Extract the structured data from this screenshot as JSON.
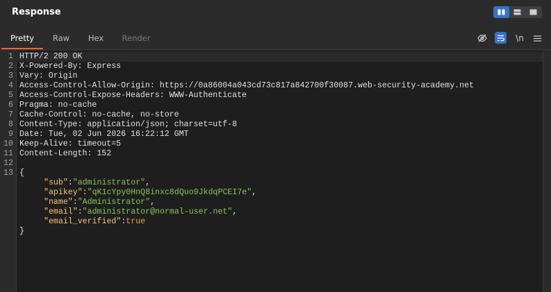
{
  "header": {
    "title": "Response"
  },
  "tabs": [
    {
      "label": "Pretty",
      "state": "active"
    },
    {
      "label": "Raw",
      "state": "normal"
    },
    {
      "label": "Hex",
      "state": "normal"
    },
    {
      "label": "Render",
      "state": "disabled"
    }
  ],
  "toolbar": {
    "hide_icon": "eye-slash-icon",
    "wrap_icon": "word-wrap-icon",
    "newline_label": "\\n",
    "menu_icon": "hamburger-menu-icon"
  },
  "colors": {
    "accent": "#e8643b",
    "selected": "#3574c9",
    "key": "#f0c674",
    "string": "#87c654",
    "boolean": "#e8a23b"
  },
  "response": {
    "line_numbers": [
      "1",
      "2",
      "3",
      "4",
      "5",
      "6",
      "7",
      "8",
      "9",
      "10",
      "11",
      "12",
      "13"
    ],
    "headers": [
      "HTTP/2 200 OK",
      "X-Powered-By: Express",
      "Vary: Origin",
      "Access-Control-Allow-Origin: https://0a86004a043cd73c817a842700f30087.web-security-academy.net",
      "Access-Control-Expose-Headers: WWW-Authenticate",
      "Pragma: no-cache",
      "Cache-Control: no-cache, no-store",
      "Content-Type: application/json; charset=utf-8",
      "Date: Tue, 02 Jun 2026 16:22:12 GMT",
      "Keep-Alive: timeout=5",
      "Content-Length: 152"
    ],
    "json_open": "{",
    "json_close": "}",
    "json": [
      {
        "key": "\"sub\"",
        "value": "\"administrator\"",
        "type": "string",
        "comma": ","
      },
      {
        "key": "\"apikey\"",
        "value": "\"qK1cYpy0HnQ8inxc8dQuo9JkdqPCEI7e\"",
        "type": "string",
        "comma": ","
      },
      {
        "key": "\"name\"",
        "value": "\"Administrator\"",
        "type": "string",
        "comma": ","
      },
      {
        "key": "\"email\"",
        "value": "\"administrator@normal-user.net\"",
        "type": "string",
        "comma": ","
      },
      {
        "key": "\"email_verified\"",
        "value": "true",
        "type": "boolean",
        "comma": ""
      }
    ]
  }
}
